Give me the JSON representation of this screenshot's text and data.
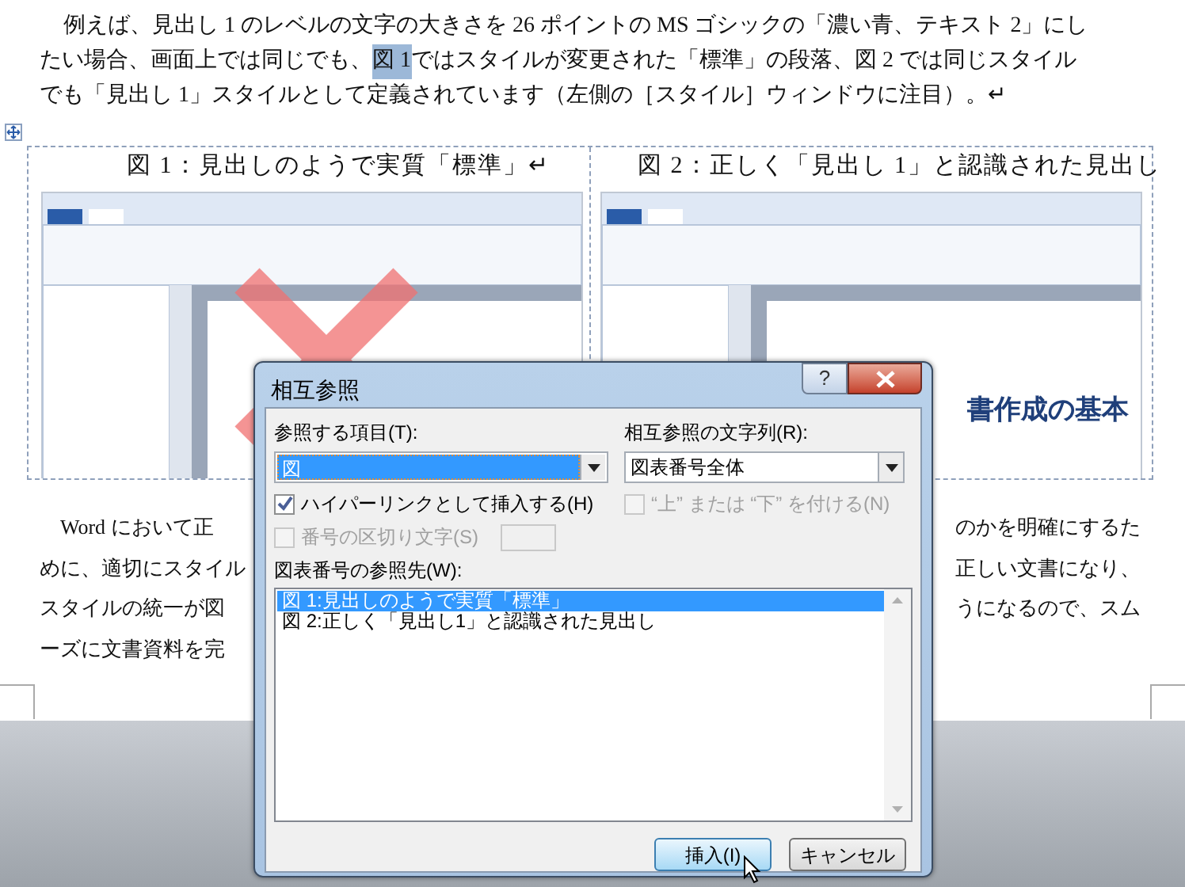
{
  "body_top": [
    [
      {
        "text": "例えば、見出し 1 のレベルの文字の大きさを 26 ポイントの MS ゴシックの「濃い青、テキスト 2」にし",
        "highlighted": false
      }
    ],
    [
      {
        "text": "たい場合、画面上では同じでも、",
        "highlighted": false
      },
      {
        "text": "図 1",
        "highlighted": true
      },
      {
        "text": " ではスタイルが変更された「標準」の段落、図 2 では同じスタイル",
        "highlighted": false
      }
    ],
    [
      {
        "text": "でも「見出し 1」スタイルとして定義されています（左側の［スタイル］ウィンドウに注目）。↵",
        "highlighted": false
      }
    ]
  ],
  "figures": [
    {
      "caption": "図 1：見出しのようで実質「標準」↵",
      "kind": "wrong"
    },
    {
      "caption": "図 2：正しく「見出し 1」と認識された見出し",
      "kind": "correct",
      "heading": "書作成の基本"
    }
  ],
  "body_bottom": [
    {
      "left": "Word において正",
      "right": "のかを明確にするた"
    },
    {
      "left": "めに、適切にスタイル",
      "right": "正しい文書になり、"
    },
    {
      "left": "スタイルの統一が図",
      "right": "うになるので、スム"
    },
    {
      "left": "ーズに文書資料を完"
    }
  ],
  "dialog": {
    "title": "相互参照",
    "help": "?",
    "reference_type": {
      "label": "参照する項目(T):",
      "value": "図"
    },
    "reference_text": {
      "label": "相互参照の文字列(R):",
      "value": "図表番号全体"
    },
    "options": [
      {
        "label": "ハイパーリンクとして挿入する(H)",
        "checked": true,
        "disabled": false
      },
      {
        "label": "“上” または “下” を付ける(N)",
        "checked": false,
        "disabled": true
      }
    ],
    "separator": {
      "label": "番号の区切り文字(S)",
      "checked": false,
      "disabled": true
    },
    "list_label": "図表番号の参照先(W):",
    "items": [
      {
        "text": "図 1:見出しのようで実質「標準」",
        "selected": true
      },
      {
        "text": "図 2:正しく「見出し1」と認識された見出し",
        "selected": false
      }
    ],
    "buttons": [
      {
        "label": "挿入(I)",
        "kind": "default"
      },
      {
        "label": "キャンセル",
        "kind": "normal"
      }
    ]
  }
}
